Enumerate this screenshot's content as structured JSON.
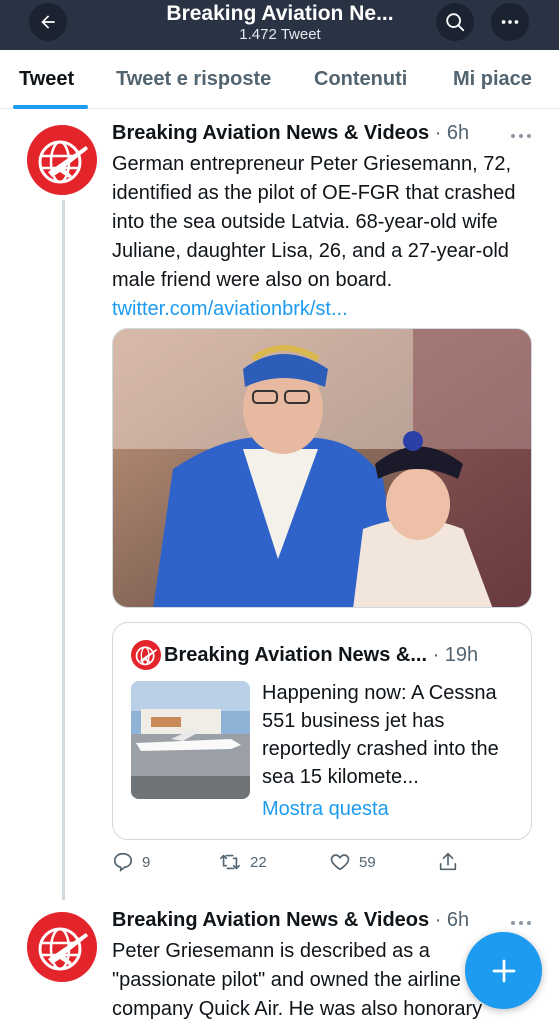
{
  "header": {
    "title": "Breaking Aviation Ne...",
    "subtitle": "1.472 Tweet",
    "background": "#2a3343"
  },
  "tabs": [
    {
      "label": "Tweet",
      "active": true
    },
    {
      "label": "Tweet e risposte",
      "active": false
    },
    {
      "label": "Contenuti",
      "active": false
    },
    {
      "label": "Mi piace",
      "active": false
    }
  ],
  "tweet1": {
    "name": "Breaking Aviation News & Videos",
    "meta": " · 6h",
    "text": "German entrepreneur Peter Griesemann, 72, identified as the pilot of OE-FGR that crashed into the sea outside Latvia. 68-year-old wife Juliane, daughter Lisa, 26, and a 27-year-old male friend were also on board. ",
    "link": "twitter.com/aviationbrk/st...",
    "quote": {
      "name": "Breaking Aviation News &...",
      "meta": " · 19h",
      "text": "Happening now: A Cessna 551 business jet has reportedly crashed into the sea 15 kilomete...",
      "show_more": "Mostra questa"
    },
    "actions": {
      "replies": "9",
      "retweets": "22",
      "likes": "59"
    }
  },
  "tweet2": {
    "name": "Breaking Aviation News & Videos",
    "meta": " · 6h",
    "text": "Peter Griesemann is described as a \"passionate pilot\" and owned the airline company Quick Air. He was also honorary"
  },
  "icons": {
    "back": "arrow-left-icon",
    "search": "search-icon",
    "more": "more-horizontal-icon",
    "compose": "plus-icon"
  },
  "colors": {
    "accent": "#1d9bf0",
    "brand_red": "#e4242b"
  }
}
